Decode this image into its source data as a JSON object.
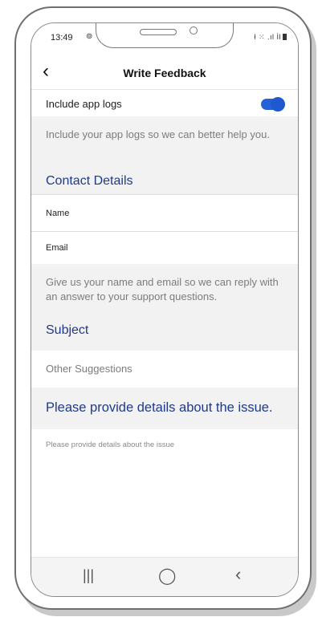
{
  "status": {
    "time": "13:49",
    "right_icons": "ł ⁙ .ıl İl"
  },
  "nav": {
    "back_icon": "back-arrow",
    "title": "Write Feedback"
  },
  "logs": {
    "label": "Include app logs",
    "enabled": true,
    "helper": "Include your app logs so we can better help you."
  },
  "contact": {
    "title": "Contact Details",
    "name_placeholder": "Name",
    "email_placeholder": "Email",
    "helper": "Give us your name and email so we can reply with an answer to your support questions."
  },
  "subject": {
    "title": "Subject",
    "value": "Other Suggestions"
  },
  "details": {
    "title": "Please provide details about the issue.",
    "placeholder": "Please provide details about the issue"
  },
  "colors": {
    "accent": "#1f58cf",
    "section_title": "#1e3a8a",
    "grey_bg": "#f2f2f2"
  }
}
